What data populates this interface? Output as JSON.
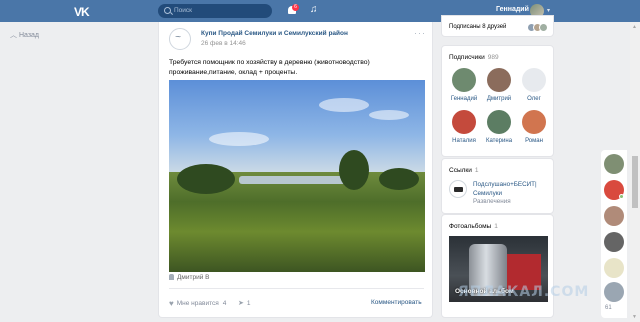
{
  "header": {
    "logo": "VK",
    "search_placeholder": "Поиск",
    "notifications_count": "6",
    "music_icon": "music-note-icon",
    "user_name": "Геннадий"
  },
  "left": {
    "back_label": "Назад"
  },
  "post": {
    "author": "Купи Продай Семилуки и Семилукский район",
    "date": "26 фев в 14:46",
    "text": "Требуется помощник по хозяйству в деревню (животноводство) проживание,питание, оклад + проценты.",
    "signer": "Дмитрий В",
    "like_label": "Мне нравится",
    "like_count": "4",
    "share_count": "1",
    "comment_label": "Комментировать"
  },
  "sidebar": {
    "subscribed_friends": "Подписаны 8 друзей",
    "subscribers_title": "Подписчики",
    "subscribers_count": "989",
    "subscribers": [
      {
        "name": "Геннадий",
        "color": "#6e8a6f"
      },
      {
        "name": "Дмитрий",
        "color": "#8b6c5c"
      },
      {
        "name": "Олег",
        "color": "#e7eaee"
      },
      {
        "name": "Наталия",
        "color": "#c44a3c"
      },
      {
        "name": "Катерина",
        "color": "#5c7d63"
      },
      {
        "name": "Роман",
        "color": "#d1754f"
      }
    ],
    "links_title": "Ссылки",
    "links_count": "1",
    "link_name": "Подслушано+БЕСИТ| Семилуки",
    "link_desc": "Развлечения",
    "albums_title": "Фотоальбомы",
    "albums_count": "1",
    "album_label": "Основной альбом"
  },
  "dock": {
    "count": "61"
  },
  "watermark": "ЯПЛАКАЛ.COM",
  "colors": {
    "header": "#4a76a8",
    "link": "#2a5885",
    "background": "#edeef0"
  }
}
